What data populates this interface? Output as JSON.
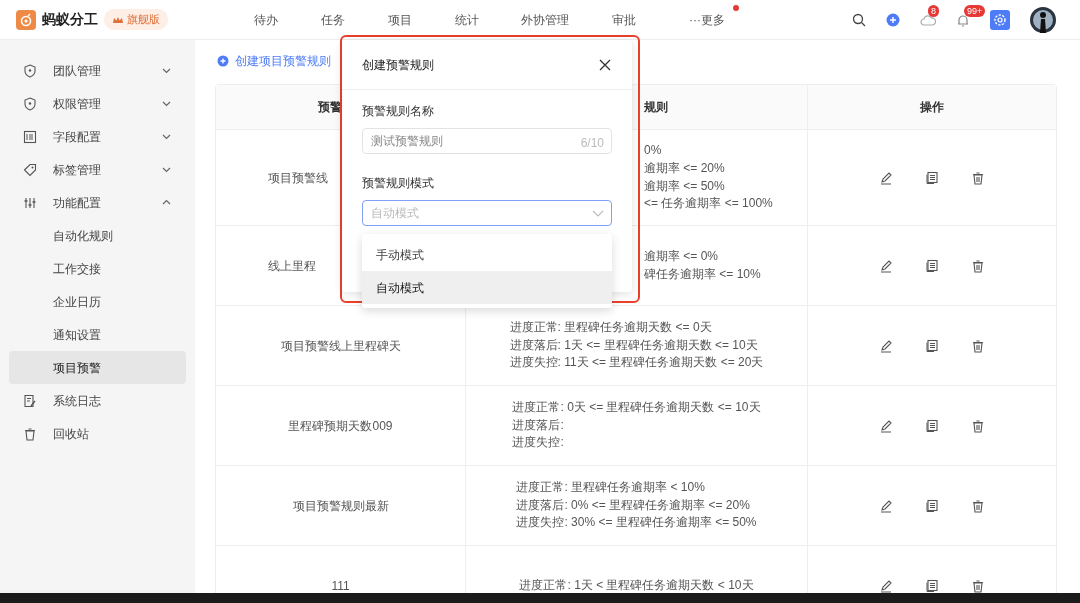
{
  "app": {
    "name": "蚂蚁分工",
    "edition": "旗舰版"
  },
  "nav": [
    {
      "label": "待办",
      "dot": false
    },
    {
      "label": "任务",
      "dot": false
    },
    {
      "label": "项目",
      "dot": false
    },
    {
      "label": "统计",
      "dot": false
    },
    {
      "label": "外协管理",
      "dot": false
    },
    {
      "label": "审批",
      "dot": false
    },
    {
      "label": "···更多",
      "dot": true
    }
  ],
  "toolbar": {
    "sync_badge": "8",
    "notification_badge": "99+"
  },
  "sidebar": {
    "items": [
      {
        "label": "团队管理",
        "expanded": false
      },
      {
        "label": "权限管理",
        "expanded": false
      },
      {
        "label": "字段配置",
        "expanded": false
      },
      {
        "label": "标签管理",
        "expanded": false
      },
      {
        "label": "功能配置",
        "expanded": true,
        "children": [
          {
            "label": "自动化规则",
            "selected": false
          },
          {
            "label": "工作交接",
            "selected": false
          },
          {
            "label": "企业日历",
            "selected": false
          },
          {
            "label": "通知设置",
            "selected": false
          },
          {
            "label": "项目预警",
            "selected": true
          }
        ]
      },
      {
        "label": "系统日志"
      },
      {
        "label": "回收站"
      }
    ]
  },
  "create_link": "创建项目预警规则",
  "table": {
    "columns": [
      {
        "label": "预警",
        "covered": true
      },
      {
        "label": "规则",
        "covered": true
      },
      {
        "label": "操作"
      }
    ],
    "rows": [
      {
        "name": "项目预警线",
        "covered": true,
        "rules": [
          "0%",
          "逾期率 <= 20%",
          "逾期率 <= 50%",
          "<= 任务逾期率 <= 100%"
        ]
      },
      {
        "name": "线上里程",
        "covered": true,
        "rules": [
          "逾期率 <= 0%",
          "碑任务逾期率 <= 10%"
        ]
      },
      {
        "name": "项目预警线上里程碑天",
        "rules": [
          "进度正常: 里程碑任务逾期天数 <= 0天",
          "进度落后: 1天 <= 里程碑任务逾期天数 <= 10天",
          "进度失控: 11天 <= 里程碑任务逾期天数 <= 20天"
        ]
      },
      {
        "name": "里程碑预期天数009",
        "rules": [
          "进度正常: 0天 <= 里程碑任务逾期天数 <= 10天",
          "进度落后:",
          "进度失控:"
        ]
      },
      {
        "name": "项目预警规则最新",
        "rules": [
          "进度正常: 里程碑任务逾期率 < 10%",
          "进度落后: 0% <= 里程碑任务逾期率 <= 20%",
          "进度失控: 30% <= 里程碑任务逾期率 <= 50%"
        ]
      },
      {
        "name": "111",
        "rules": [
          "进度正常: 1天 < 里程碑任务逾期天数 < 10天"
        ]
      }
    ]
  },
  "dialog": {
    "title": "创建预警规则",
    "name_field": {
      "label": "预警规则名称",
      "value": "测试预警规则",
      "counter": "6/10"
    },
    "mode_field": {
      "label": "预警规则模式",
      "placeholder": "自动模式",
      "open": true,
      "options": [
        {
          "label": "手动模式",
          "selected": false
        },
        {
          "label": "自动模式",
          "selected": true
        }
      ]
    }
  }
}
